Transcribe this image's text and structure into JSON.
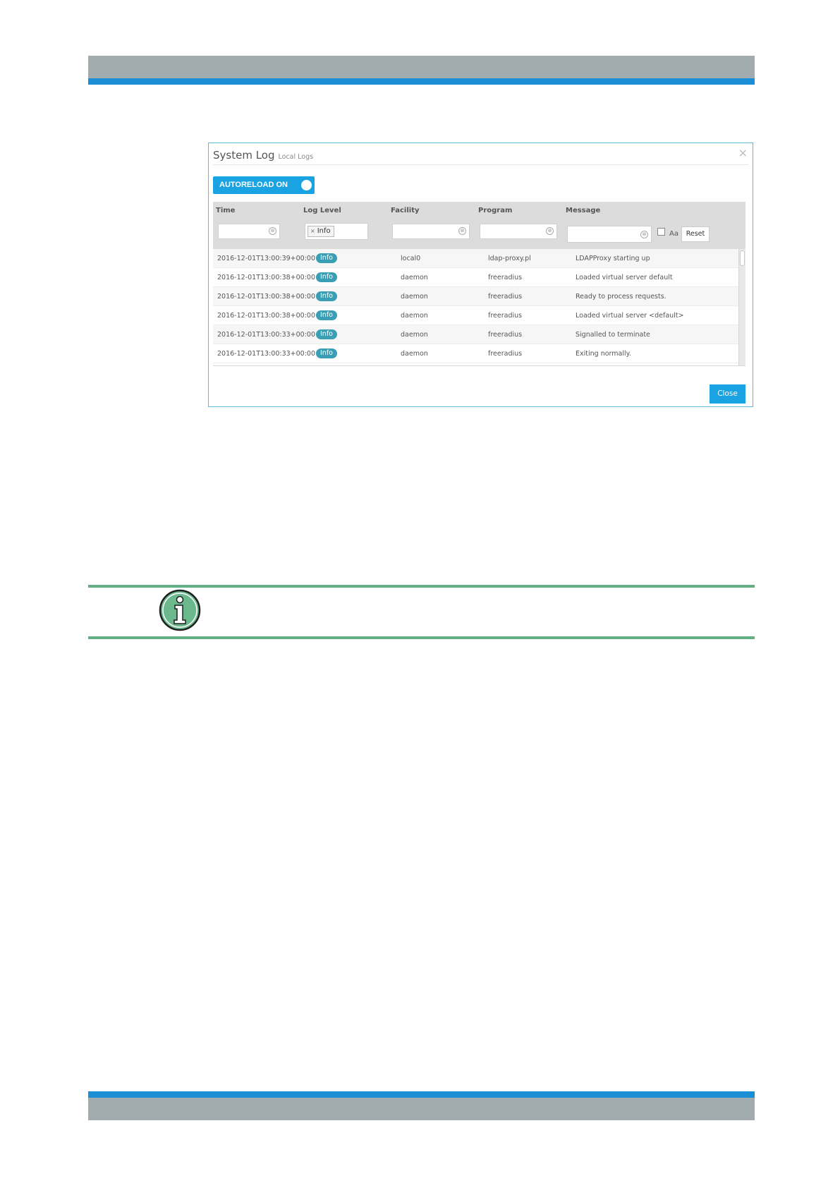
{
  "dialog": {
    "title": "System Log",
    "subtitle": "Local Logs",
    "close_glyph": "×",
    "autoreload_label": "AUTORELOAD ON",
    "autoreload_state": "on",
    "close_label": "Close"
  },
  "columns": [
    "Time",
    "Log Level",
    "Facility",
    "Program",
    "Message"
  ],
  "filters": {
    "log_level_selected": "Info",
    "chip_remove_glyph": "×",
    "clear_glyph": "⊗",
    "case_label": "Aa",
    "case_checked": false,
    "reset_label": "Reset"
  },
  "rows": [
    {
      "time": "2016-12-01T13:00:39+00:00",
      "level": "Info",
      "facility": "local0",
      "program": "ldap-proxy.pl",
      "message": "LDAPProxy starting up"
    },
    {
      "time": "2016-12-01T13:00:38+00:00",
      "level": "Info",
      "facility": "daemon",
      "program": "freeradius",
      "message": "Loaded virtual server default"
    },
    {
      "time": "2016-12-01T13:00:38+00:00",
      "level": "Info",
      "facility": "daemon",
      "program": "freeradius",
      "message": "Ready to process requests."
    },
    {
      "time": "2016-12-01T13:00:38+00:00",
      "level": "Info",
      "facility": "daemon",
      "program": "freeradius",
      "message": "Loaded virtual server <default>"
    },
    {
      "time": "2016-12-01T13:00:33+00:00",
      "level": "Info",
      "facility": "daemon",
      "program": "freeradius",
      "message": "Signalled to terminate"
    },
    {
      "time": "2016-12-01T13:00:33+00:00",
      "level": "Info",
      "facility": "daemon",
      "program": "freeradius",
      "message": "Exiting normally."
    }
  ],
  "colors": {
    "header_band": "#a2abb0",
    "accent_blue": "#1b8fd6",
    "button_blue": "#1aa3e3",
    "badge_teal": "#3a9fb5",
    "note_green": "#64ae84"
  },
  "icons": [
    "info-icon",
    "close-icon",
    "clear-icon"
  ]
}
